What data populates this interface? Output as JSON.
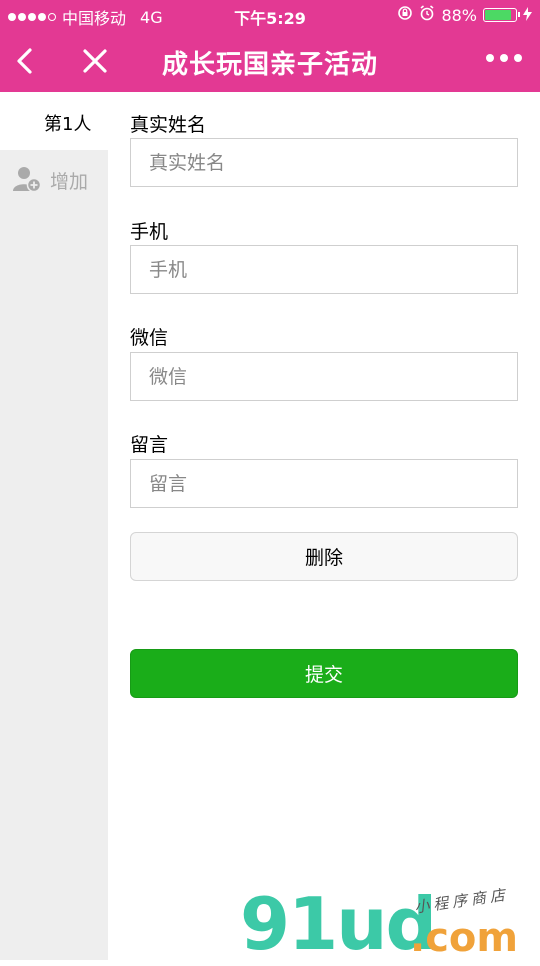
{
  "status_bar": {
    "carrier": "中国移动",
    "network": "4G",
    "time": "下午5:29",
    "battery": "88%",
    "battery_level": 0.88
  },
  "nav": {
    "title": "成长玩国亲子活动"
  },
  "sidebar": {
    "tabs": [
      {
        "label": "第1人"
      }
    ],
    "add_label": "增加"
  },
  "form": {
    "fields": [
      {
        "label": "真实姓名",
        "placeholder": "真实姓名",
        "value": ""
      },
      {
        "label": "手机",
        "placeholder": "手机",
        "value": ""
      },
      {
        "label": "微信",
        "placeholder": "微信",
        "value": ""
      },
      {
        "label": "留言",
        "placeholder": "留言",
        "value": ""
      }
    ],
    "delete_label": "删除",
    "submit_label": "提交"
  },
  "watermark": {
    "brand": "91ud",
    "domain": ".com",
    "tagline": "小程序商店"
  },
  "colors": {
    "header": "#e33993",
    "submit": "#1aad19",
    "sidebar": "#eeeeee"
  }
}
